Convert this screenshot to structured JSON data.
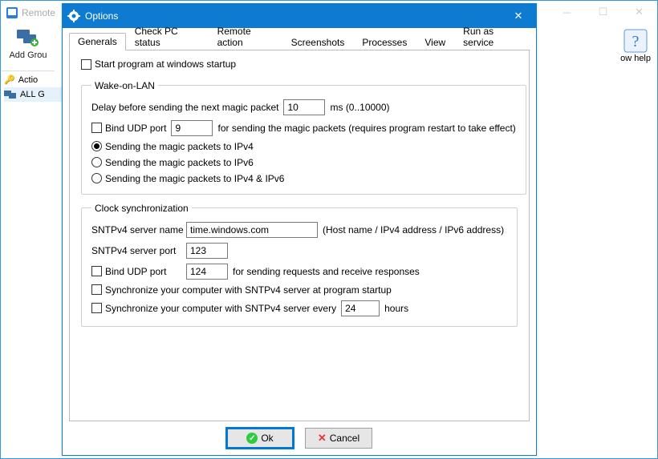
{
  "bg": {
    "title": "Remote",
    "tool_addgroup": "Add Grou",
    "help_label": "ow help",
    "tree": {
      "actions": "Actio",
      "allg": "ALL G"
    }
  },
  "dialog": {
    "title": "Options",
    "tabs": {
      "generals": "Generals",
      "checkpc": "Check PC status",
      "remoteaction": "Remote action",
      "screenshots": "Screenshots",
      "processes": "Processes",
      "view": "View",
      "runservice": "Run as service"
    },
    "general": {
      "start_at_startup": "Start program at windows startup"
    },
    "wol": {
      "legend": "Wake-on-LAN",
      "delay_label": "Delay before sending the next magic packet",
      "delay_value": "10",
      "delay_suffix": "ms  (0..10000)",
      "bind_udp": "Bind UDP port",
      "udp_port": "9",
      "udp_suffix": "for sending the magic packets (requires program restart to take effect)",
      "r_ipv4": "Sending the magic packets to IPv4",
      "r_ipv6": "Sending the magic packets to IPv6",
      "r_both": "Sending the magic packets to IPv4 & IPv6"
    },
    "clock": {
      "legend": "Clock synchronization",
      "server_name_label": "SNTPv4 server name",
      "server_name_value": "time.windows.com",
      "server_name_hint": "(Host name / IPv4 address / IPv6 address)",
      "server_port_label": "SNTPv4 server port",
      "server_port_value": "123",
      "bind_udp": "Bind UDP port",
      "bind_udp_value": "124",
      "bind_udp_suffix": "for sending requests and receive responses",
      "sync_startup": "Synchronize your computer with SNTPv4 server at program startup",
      "sync_every_prefix": "Synchronize your computer with SNTPv4 server every",
      "sync_every_value": "24",
      "sync_every_suffix": "hours"
    },
    "buttons": {
      "ok": "Ok",
      "cancel": "Cancel"
    }
  }
}
